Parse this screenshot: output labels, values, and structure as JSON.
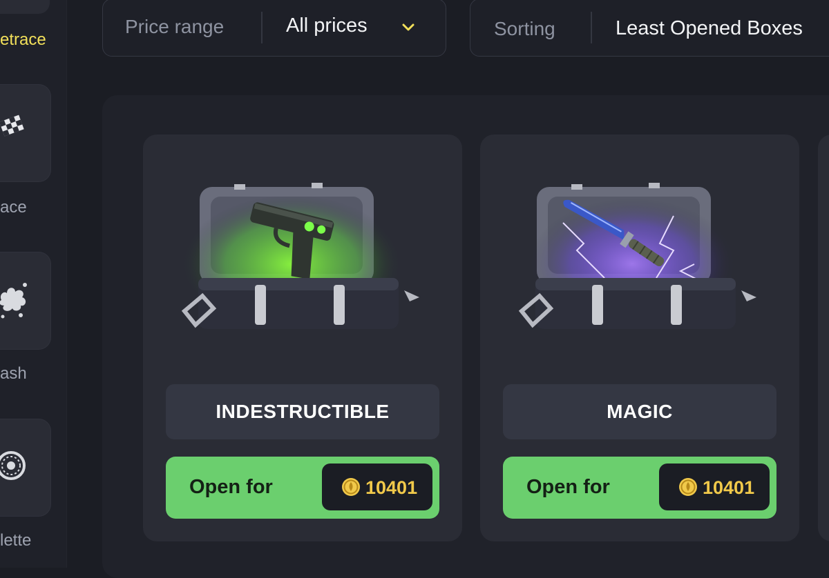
{
  "sidebar": {
    "items": [
      {
        "label": "etrace",
        "icon": "tracing-icon",
        "active": true
      },
      {
        "label": "ace",
        "icon": "checkered-flag-icon",
        "active": false
      },
      {
        "label": "ash",
        "icon": "explosion-icon",
        "active": false
      },
      {
        "label": "lette",
        "icon": "roulette-icon",
        "active": false
      }
    ]
  },
  "filters": {
    "price": {
      "label": "Price range",
      "value": "All prices"
    },
    "sorting": {
      "label": "Sorting",
      "value": "Least Opened Boxes"
    }
  },
  "cases": [
    {
      "name": "INDESTRUCTIBLE",
      "button_label": "Open for",
      "price": "10401",
      "art": "pistol-case-icon",
      "glow": "#7dff3a"
    },
    {
      "name": "MAGIC",
      "button_label": "Open for",
      "price": "10401",
      "art": "knife-case-icon",
      "glow": "#8a5cff"
    }
  ],
  "colors": {
    "accent_yellow": "#f2e05a",
    "button_green": "#6bcf6e",
    "coin_gold": "#f1c94a"
  }
}
